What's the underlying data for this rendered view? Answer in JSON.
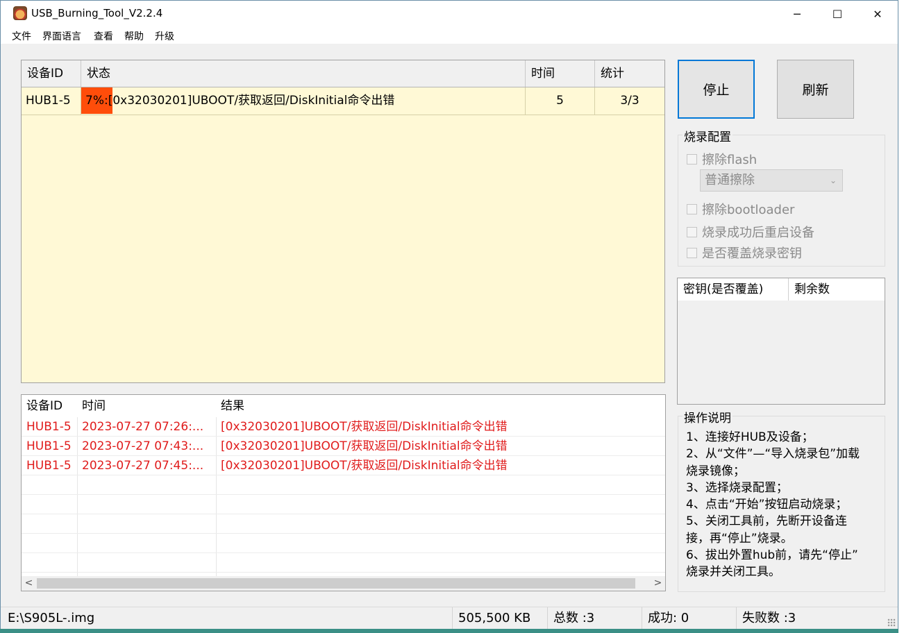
{
  "window": {
    "title": "USB_Burning_Tool_V2.2.4",
    "minimize_glyph": "─",
    "maximize_glyph": "☐",
    "close_glyph": "✕"
  },
  "menu": [
    "文件",
    "界面语言",
    "查看",
    "帮助",
    "升级"
  ],
  "device_table": {
    "headers": [
      "设备ID",
      "状态",
      "时间",
      "统计"
    ],
    "rows": [
      {
        "device_id": "HUB1-5",
        "status": "7%:[0x32030201]UBOOT/获取返回/DiskInitial命令出错",
        "progress_percent": 7,
        "time": "5",
        "stats": "3/3"
      }
    ],
    "progress_color": "#ff4d0a",
    "background_color": "#fff9d6"
  },
  "buttons": {
    "stop": "停止",
    "refresh": "刷新"
  },
  "burn_config": {
    "title": "烧录配置",
    "erase_flash": {
      "label": "擦除flash",
      "checked": false,
      "enabled": false
    },
    "erase_mode": {
      "selected": "普通擦除",
      "enabled": false
    },
    "erase_bootloader": {
      "label": "擦除bootloader",
      "checked": false,
      "enabled": false
    },
    "reboot_after_success": {
      "label": "烧录成功后重启设备",
      "checked": false,
      "enabled": false
    },
    "overwrite_key": {
      "label": "是否覆盖烧录密钥",
      "checked": false,
      "enabled": false
    }
  },
  "key_list": {
    "headers": [
      "密钥(是否覆盖)",
      "剩余数"
    ]
  },
  "instructions": {
    "title": "操作说明",
    "lines": [
      "1、连接好HUB及设备；",
      "2、从“文件”—“导入烧录包”加载",
      "烧录镜像；",
      "3、选择烧录配置；",
      "4、点击“开始”按钮启动烧录；",
      "5、关闭工具前，先断开设备连",
      "接，再“停止”烧录。",
      "6、拔出外置hub前，请先“停止”",
      "烧录并关闭工具。"
    ]
  },
  "log": {
    "headers": [
      "设备ID",
      "时间",
      "结果"
    ],
    "rows": [
      {
        "device_id": "HUB1-5",
        "time": "2023-07-27 07:26:...",
        "result": "[0x32030201]UBOOT/获取返回/DiskInitial命令出错"
      },
      {
        "device_id": "HUB1-5",
        "time": "2023-07-27 07:43:...",
        "result": "[0x32030201]UBOOT/获取返回/DiskInitial命令出错"
      },
      {
        "device_id": "HUB1-5",
        "time": "2023-07-27 07:45:...",
        "result": "[0x32030201]UBOOT/获取返回/DiskInitial命令出错"
      }
    ],
    "error_color": "#e01b1b",
    "scroll_left_glyph": "<",
    "scroll_right_glyph": ">"
  },
  "statusbar": {
    "image_path": "E:\\S905L-.img",
    "size": "505,500 KB",
    "total": "总数 :3",
    "success": "成功:  0",
    "failed": "失败数 :3"
  }
}
